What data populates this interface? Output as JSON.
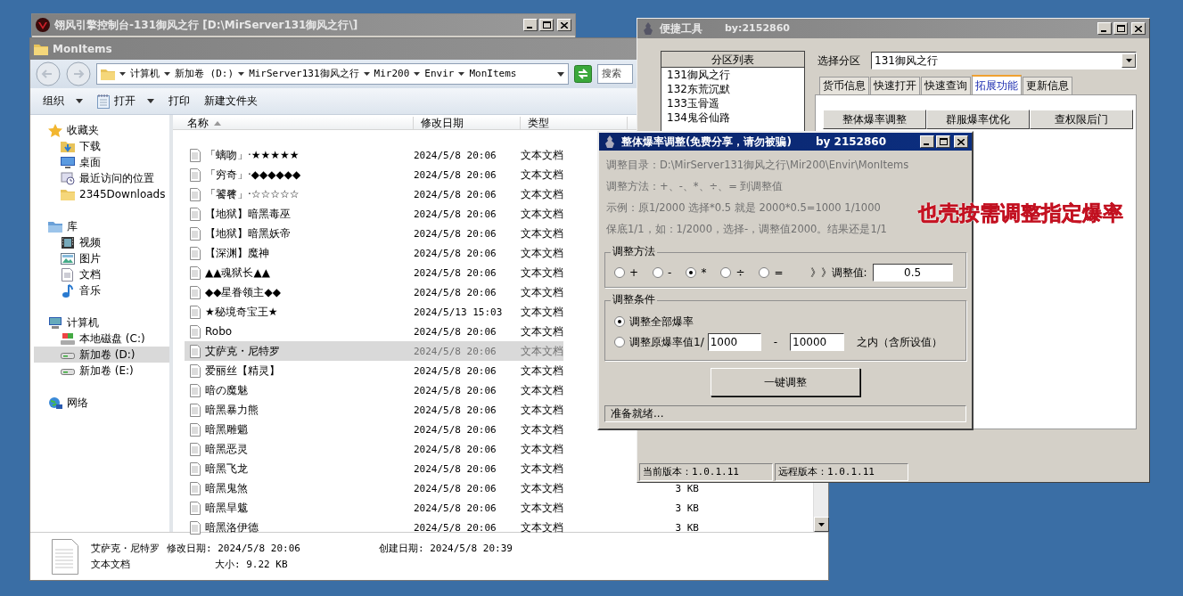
{
  "background_window": {
    "title": "翎风引擎控制台-131御风之行 [D:\\MirServer131御风之行\\]"
  },
  "explorer": {
    "title": "MonItems",
    "breadcrumbs": [
      "计算机",
      "新加卷 (D:)",
      "MirServer131御风之行",
      "Mir200",
      "Envir",
      "MonItems"
    ],
    "search": {
      "placeholder": "搜索"
    },
    "toolbar": [
      {
        "label": "组织",
        "dropdown": true
      },
      {
        "label": "打开",
        "dropdown": true
      },
      {
        "label": "打印",
        "dropdown": false
      },
      {
        "label": "新建文件夹",
        "dropdown": false
      }
    ],
    "nav": [
      {
        "label": "收藏夹",
        "selected": false,
        "children": [
          {
            "label": "下载",
            "selected": false
          },
          {
            "label": "桌面",
            "selected": false
          },
          {
            "label": "最近访问的位置",
            "selected": false
          },
          {
            "label": "2345Downloads",
            "selected": false
          }
        ]
      },
      {
        "label": "库",
        "selected": false,
        "children": [
          {
            "label": "视频",
            "selected": false
          },
          {
            "label": "图片",
            "selected": false
          },
          {
            "label": "文档",
            "selected": false
          },
          {
            "label": "音乐",
            "selected": false
          }
        ]
      },
      {
        "label": "计算机",
        "selected": false,
        "children": [
          {
            "label": "本地磁盘 (C:)",
            "selected": false
          },
          {
            "label": "新加卷 (D:)",
            "selected": true
          },
          {
            "label": "新加卷 (E:)",
            "selected": false
          }
        ]
      },
      {
        "label": "网络",
        "selected": false
      }
    ],
    "columns": [
      {
        "label": "名称",
        "sorted": true
      },
      {
        "label": "修改日期",
        "sorted": false
      },
      {
        "label": "类型",
        "sorted": false
      }
    ],
    "rows": [
      {
        "name": "「螭吻」·★★★★★",
        "modified": "2024/5/8 20:06",
        "type": "文本文档",
        "selected": false
      },
      {
        "name": "「穷奇」·◆◆◆◆◆◆",
        "modified": "2024/5/8 20:06",
        "type": "文本文档",
        "selected": false
      },
      {
        "name": "「饕餮」·☆☆☆☆☆",
        "modified": "2024/5/8 20:06",
        "type": "文本文档",
        "selected": false
      },
      {
        "name": "【地狱】暗黑毒巫",
        "modified": "2024/5/8 20:06",
        "type": "文本文档",
        "selected": false
      },
      {
        "name": "【地狱】暗黑妖帝",
        "modified": "2024/5/8 20:06",
        "type": "文本文档",
        "selected": false
      },
      {
        "name": "【深渊】魔神",
        "modified": "2024/5/8 20:06",
        "type": "文本文档",
        "selected": false
      },
      {
        "name": "▲▲魂狱长▲▲",
        "modified": "2024/5/8 20:06",
        "type": "文本文档",
        "selected": false
      },
      {
        "name": "◆◆星眷领主◆◆",
        "modified": "2024/5/8 20:06",
        "type": "文本文档",
        "selected": false
      },
      {
        "name": "★秘境奇宝王★",
        "modified": "2024/5/13 15:03",
        "type": "文本文档",
        "selected": false
      },
      {
        "name": "Robo",
        "modified": "2024/5/8 20:06",
        "type": "文本文档",
        "selected": false
      },
      {
        "name": "艾萨克・尼特罗",
        "modified": "2024/5/8 20:06",
        "type": "文本文档",
        "selected": true
      },
      {
        "name": "爱丽丝【精灵】",
        "modified": "2024/5/8 20:06",
        "type": "文本文档",
        "selected": false
      },
      {
        "name": "暗の魔魅",
        "modified": "2024/5/8 20:06",
        "type": "文本文档",
        "selected": false
      },
      {
        "name": "暗黑暴力熊",
        "modified": "2024/5/8 20:06",
        "type": "文本文档",
        "selected": false
      },
      {
        "name": "暗黑雕魈",
        "modified": "2024/5/8 20:06",
        "type": "文本文档",
        "selected": false
      },
      {
        "name": "暗黑恶灵",
        "modified": "2024/5/8 20:06",
        "type": "文本文档",
        "selected": false
      },
      {
        "name": "暗黑飞龙",
        "modified": "2024/5/8 20:06",
        "type": "文本文档",
        "selected": false
      },
      {
        "name": "暗黑鬼煞",
        "modified": "2024/5/8 20:06",
        "type": "文本文档",
        "size": "3 KB",
        "selected": false
      },
      {
        "name": "暗黑旱魃",
        "modified": "2024/5/8 20:06",
        "type": "文本文档",
        "size": "3 KB",
        "selected": false
      },
      {
        "name": "暗黑洛伊德",
        "modified": "2024/5/8 20:06",
        "type": "文本文档",
        "size": "3 KB",
        "selected": false
      }
    ],
    "details": {
      "name": "艾萨克・尼特罗",
      "modified": "修改日期: 2024/5/8 20:06",
      "created": "创建日期: 2024/5/8 20:39",
      "type": "文本文档",
      "size": "大小: 9.22 KB"
    }
  },
  "tool_window": {
    "title": "便捷工具",
    "author": "by:2152860",
    "partition_list": {
      "header": "分区列表",
      "items": [
        "131御风之行",
        "132东荒沉默",
        "133玉骨遥",
        "134鬼谷仙路"
      ]
    },
    "partition_select": {
      "label": "选择分区",
      "value": "131御风之行"
    },
    "tabs": [
      {
        "label": "货币信息",
        "selected": false
      },
      {
        "label": "快速打开",
        "selected": false
      },
      {
        "label": "快速查询",
        "selected": false
      },
      {
        "label": "拓展功能",
        "selected": true
      },
      {
        "label": "更新信息",
        "selected": false
      }
    ],
    "buttons": [
      "整体爆率调整",
      "群服爆率优化",
      "查权限后门"
    ],
    "status": [
      "当前版本：1.0.1.11",
      "远程版本：1.0.1.11"
    ]
  },
  "dialog": {
    "title": "整体爆率调整(免费分享，请勿被骗)",
    "author": "by 2152860",
    "lines": [
      "调整目录：D:\\MirServer131御风之行\\Mir200\\Envir\\MonItems",
      "调整方法：+、-、*、÷、=   到调整值",
      "示例：原1/2000 选择*0.5 就是 2000*0.5=1000  1/1000",
      "保底1/1，如：1/2000，选择-，调整值2000。结果还是1/1"
    ],
    "method_group": {
      "title": "调整方法",
      "options": [
        {
          "label": "+",
          "selected": false
        },
        {
          "label": "-",
          "selected": false
        },
        {
          "label": "*",
          "selected": true
        },
        {
          "label": "÷",
          "selected": false
        },
        {
          "label": "=",
          "selected": false
        }
      ],
      "value_label": "》》调整值:",
      "value": "0.5"
    },
    "condition_group": {
      "title": "调整条件",
      "options": [
        {
          "label": "调整全部爆率",
          "selected": true
        },
        {
          "label": "调整原爆率值1/",
          "selected": false
        }
      ],
      "from": "1000",
      "separator": "-",
      "to": "10000",
      "suffix": "之内（含所设值）"
    },
    "button": "一键调整",
    "status": "准备就绪..."
  },
  "annotation": "也壳按需调整指定爆率"
}
